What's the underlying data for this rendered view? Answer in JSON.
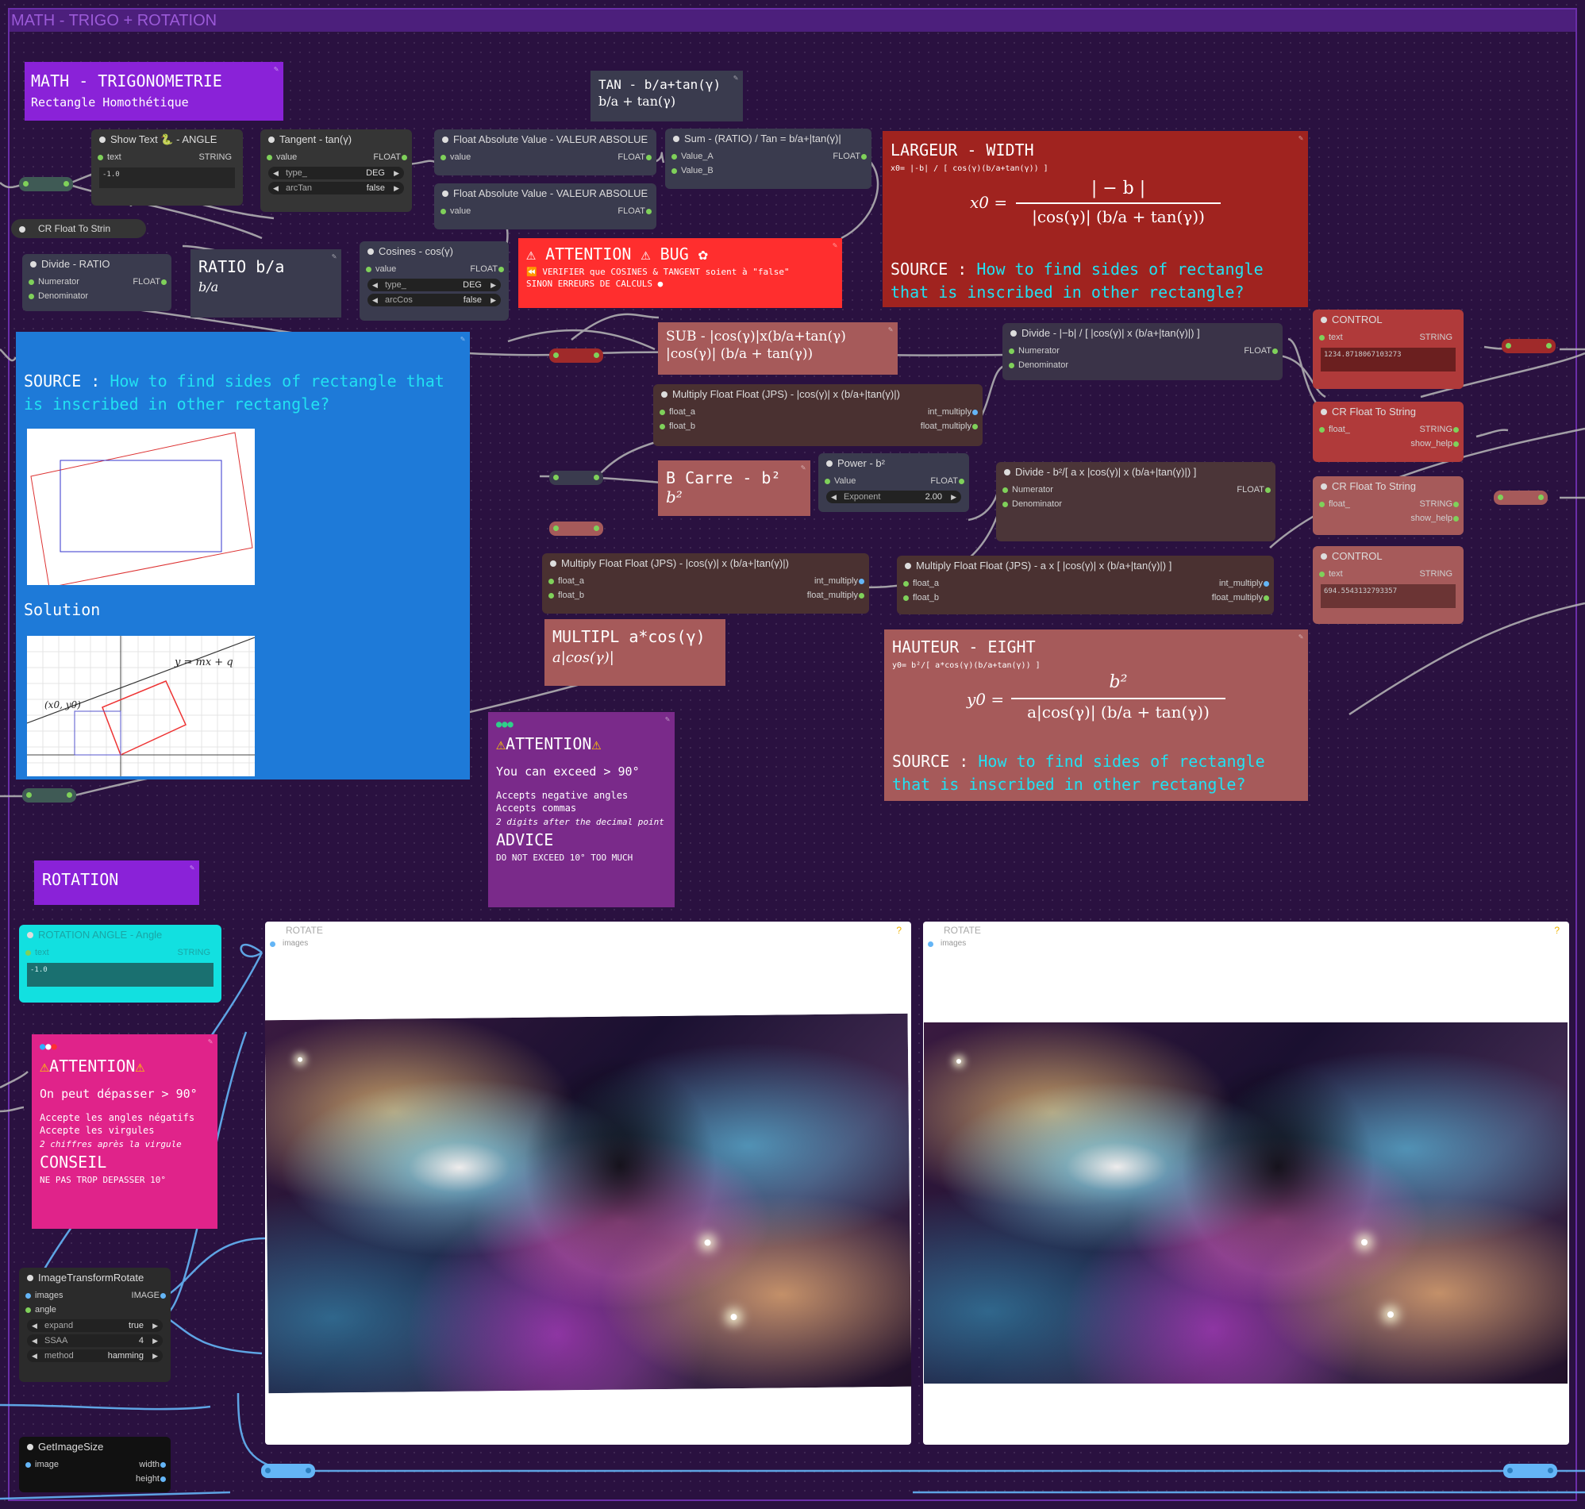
{
  "group": {
    "title": "MATH - TRIGO + ROTATION"
  },
  "notes": {
    "title_main": {
      "heading": "MATH - TRIGONOMETRIE",
      "sub": "Rectangle Homothétique"
    },
    "tan_note": {
      "line1": "TAN - b/a+tan(γ)",
      "line2": "b/a + tan(γ)"
    },
    "ratio_note": {
      "heading": "RATIO b/a",
      "formula": "b/a"
    },
    "bug": {
      "heading": "ATTENTION",
      "heading2": "BUG",
      "line1": "VERIFIER que COSINES & TANGENT soient à \"false\"",
      "line2": "SINON ERREURS DE CALCULS"
    },
    "largeur": {
      "heading": "LARGEUR - WIDTH",
      "small": "x0= |-b| / [ cos(γ)(b/a+tan(γ)) ]",
      "lhs": "x0 =",
      "num": "| − b |",
      "den": "|cos(γ)| (b/a + tan(γ))",
      "source_label": "SOURCE :",
      "source_text": "How to find sides of rectangle that is inscribed in other rectangle?"
    },
    "source_blue": {
      "source_label": "SOURCE :",
      "source_text": "How to find sides of rectangle that is inscribed in other rectangle?",
      "solution": "Solution",
      "eq": "y = mx + q",
      "pt": "(x0, y0)"
    },
    "sub": {
      "line1": "SUB - |cos(γ)|x(b/a+tan(γ)",
      "line2": "|cos(γ)| (b/a + tan(γ))"
    },
    "bcarre": {
      "heading": "B Carre - b²",
      "formula": "b²"
    },
    "multipl": {
      "heading": "MULTIPL a*cos(γ)",
      "formula": "a|cos(γ)|"
    },
    "hauteur": {
      "heading": "HAUTEUR - EIGHT",
      "small": "y0= b²/[ a*cos(γ)(b/a+tan(γ)) ]",
      "lhs": "y0 =",
      "num": "b²",
      "den": "a|cos(γ)| (b/a + tan(γ))",
      "source_label": "SOURCE :",
      "source_text": "How to find sides of rectangle that is inscribed in other rectangle?"
    },
    "attention_en": {
      "heading": "ATTENTION",
      "line1": "You can exceed > 90°",
      "line2": "Accepts negative angles",
      "line3": "Accepts commas",
      "line4": "2 digits after the decimal point",
      "advice": "ADVICE",
      "advice_text": "DO NOT EXCEED 10° TOO MUCH"
    },
    "rotation": {
      "heading": "ROTATION"
    },
    "attention_fr": {
      "heading": "ATTENTION",
      "line1": "On peut dépasser > 90°",
      "line2": "Accepte les angles négatifs",
      "line3": "Accepte les virgules",
      "line4": "2 chiffres après la virgule",
      "advice": "CONSEIL",
      "advice_text": "NE PAS TROP DEPASSER 10°"
    }
  },
  "nodes": {
    "show_text": {
      "title": "Show Text 🐍 - ANGLE",
      "in": "text",
      "out": "STRING",
      "value": "-1.0"
    },
    "cr_float_small": {
      "title": "CR Float To Strin"
    },
    "tangent": {
      "title": "Tangent - tan(γ)",
      "in": "value",
      "out": "FLOAT",
      "w1_label": "type_",
      "w1_value": "DEG",
      "w2_label": "arcTan",
      "w2_value": "false"
    },
    "abs1": {
      "title": "Float Absolute Value - VALEUR ABSOLUE",
      "in": "value",
      "out": "FLOAT"
    },
    "abs2": {
      "title": "Float Absolute Value - VALEUR ABSOLUE",
      "in": "value",
      "out": "FLOAT"
    },
    "sum": {
      "title": "Sum - (RATIO) / Tan = b/a+|tan(γ)|",
      "in1": "Value_A",
      "in2": "Value_B",
      "out": "FLOAT"
    },
    "divide_ratio": {
      "title": "Divide - RATIO",
      "in1": "Numerator",
      "in2": "Denominator",
      "out": "FLOAT"
    },
    "cosines": {
      "title": "Cosines - cos(γ)",
      "in": "value",
      "out": "FLOAT",
      "w1_label": "type_",
      "w1_value": "DEG",
      "w2_label": "arcCos",
      "w2_value": "false"
    },
    "divide_x0": {
      "title": "Divide - |−b| / [ |cos(γ)| x (b/a+|tan(γ)|) ]",
      "in1": "Numerator",
      "in2": "Denominator",
      "out": "FLOAT"
    },
    "multiply1": {
      "title": "Multiply Float Float (JPS) - |cos(γ)| x (b/a+|tan(γ)|)",
      "in1": "float_a",
      "in2": "float_b",
      "out1": "int_multiply",
      "out2": "float_multiply"
    },
    "power": {
      "title": "Power - b²",
      "in": "Value",
      "out": "FLOAT",
      "w1_label": "Exponent",
      "w1_value": "2.00"
    },
    "divide_y0": {
      "title": "Divide - b²/[ a x |cos(γ)| x (b/a+|tan(γ)|) ]",
      "in1": "Numerator",
      "in2": "Denominator",
      "out": "FLOAT"
    },
    "multiply2": {
      "title": "Multiply Float Float (JPS) - |cos(γ)| x (b/a+|tan(γ)|)",
      "in1": "float_a",
      "in2": "float_b",
      "out1": "int_multiply",
      "out2": "float_multiply"
    },
    "multiply3": {
      "title": "Multiply Float Float (JPS) - a x [ |cos(γ)| x (b/a+|tan(γ)|) ]",
      "in1": "float_a",
      "in2": "float_b",
      "out1": "int_multiply",
      "out2": "float_multiply"
    },
    "control1": {
      "title": "CONTROL",
      "in": "text",
      "out": "STRING",
      "value": "1234.8718067103273"
    },
    "cr_float1": {
      "title": "CR Float To String",
      "in": "float_",
      "out1": "STRING",
      "out2": "show_help"
    },
    "cr_float2": {
      "title": "CR Float To String",
      "in": "float_",
      "out1": "STRING",
      "out2": "show_help"
    },
    "control2": {
      "title": "CONTROL",
      "in": "text",
      "out": "STRING",
      "value": "694.5543132793357"
    },
    "rotation_angle": {
      "title": "ROTATION ANGLE - Angle",
      "in": "text",
      "out": "STRING",
      "value": "-1.0"
    },
    "rotate_node": {
      "title": "ImageTransformRotate",
      "in1": "images",
      "in2": "angle",
      "out": "IMAGE",
      "w1_label": "expand",
      "w1_value": "true",
      "w2_label": "SSAA",
      "w2_value": "4",
      "w3_label": "method",
      "w3_value": "hamming"
    },
    "get_size": {
      "title": "GetImageSize",
      "in": "image",
      "out1": "width",
      "out2": "height"
    }
  },
  "previews": [
    {
      "title": "ROTATE",
      "input": "images",
      "help": "?"
    },
    {
      "title": "ROTATE",
      "input": "images",
      "help": "?"
    }
  ],
  "colors": {
    "cyan": "#22e1f2",
    "purple_note": "#8a22d8",
    "red_note": "#a0231f",
    "blue_note": "#1e7ad8",
    "pink_note": "#e0238a",
    "bug_note": "#ff2e2e"
  }
}
